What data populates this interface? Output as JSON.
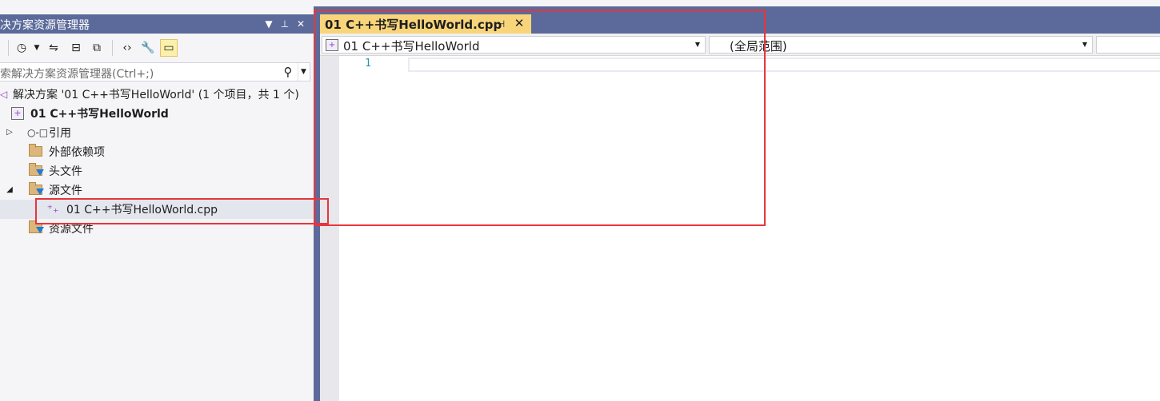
{
  "solution_explorer": {
    "title": "决方案资源管理器",
    "title_buttons": {
      "dropdown": "▼",
      "pin": "⊥",
      "close": "✕"
    },
    "search_placeholder": "索解决方案资源管理器(Ctrl+;)",
    "tree": {
      "solution": "解决方案 '01 C++书写HelloWorld' (1 个项目，共 1 个)",
      "project": "01 C++书写HelloWorld",
      "references": "引用",
      "external_deps": "外部依赖项",
      "header_files": "头文件",
      "source_files": "源文件",
      "source_file_item": "01 C++书写HelloWorld.cpp",
      "resource_files": "资源文件"
    }
  },
  "editor": {
    "tab_label": "01 C++书写HelloWorld.cpp",
    "nav_project": "01 C++书写HelloWorld",
    "nav_scope": "(全局范围)",
    "line_number": "1"
  },
  "colors": {
    "title_bar": "#5b6a9a",
    "active_tab": "#f8d57b",
    "annotation_red": "#e8353c",
    "line_number": "#2b91af"
  }
}
